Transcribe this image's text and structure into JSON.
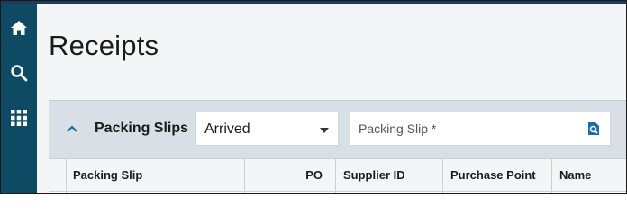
{
  "nav": {
    "items": [
      {
        "icon": "home-icon"
      },
      {
        "icon": "search-icon"
      },
      {
        "icon": "apps-grid-icon"
      }
    ]
  },
  "page": {
    "title": "Receipts"
  },
  "section": {
    "title": "Packing Slips",
    "filter_select": {
      "value": "Arrived"
    },
    "search": {
      "placeholder": "Packing Slip *",
      "value": ""
    },
    "table": {
      "columns": [
        "",
        "Packing Slip",
        "PO",
        "Supplier ID",
        "Purchase Point",
        "Name"
      ]
    }
  },
  "colors": {
    "rail": "#0e4a63",
    "section_bg": "#d8e0e6",
    "accent": "#1a6fa8"
  }
}
